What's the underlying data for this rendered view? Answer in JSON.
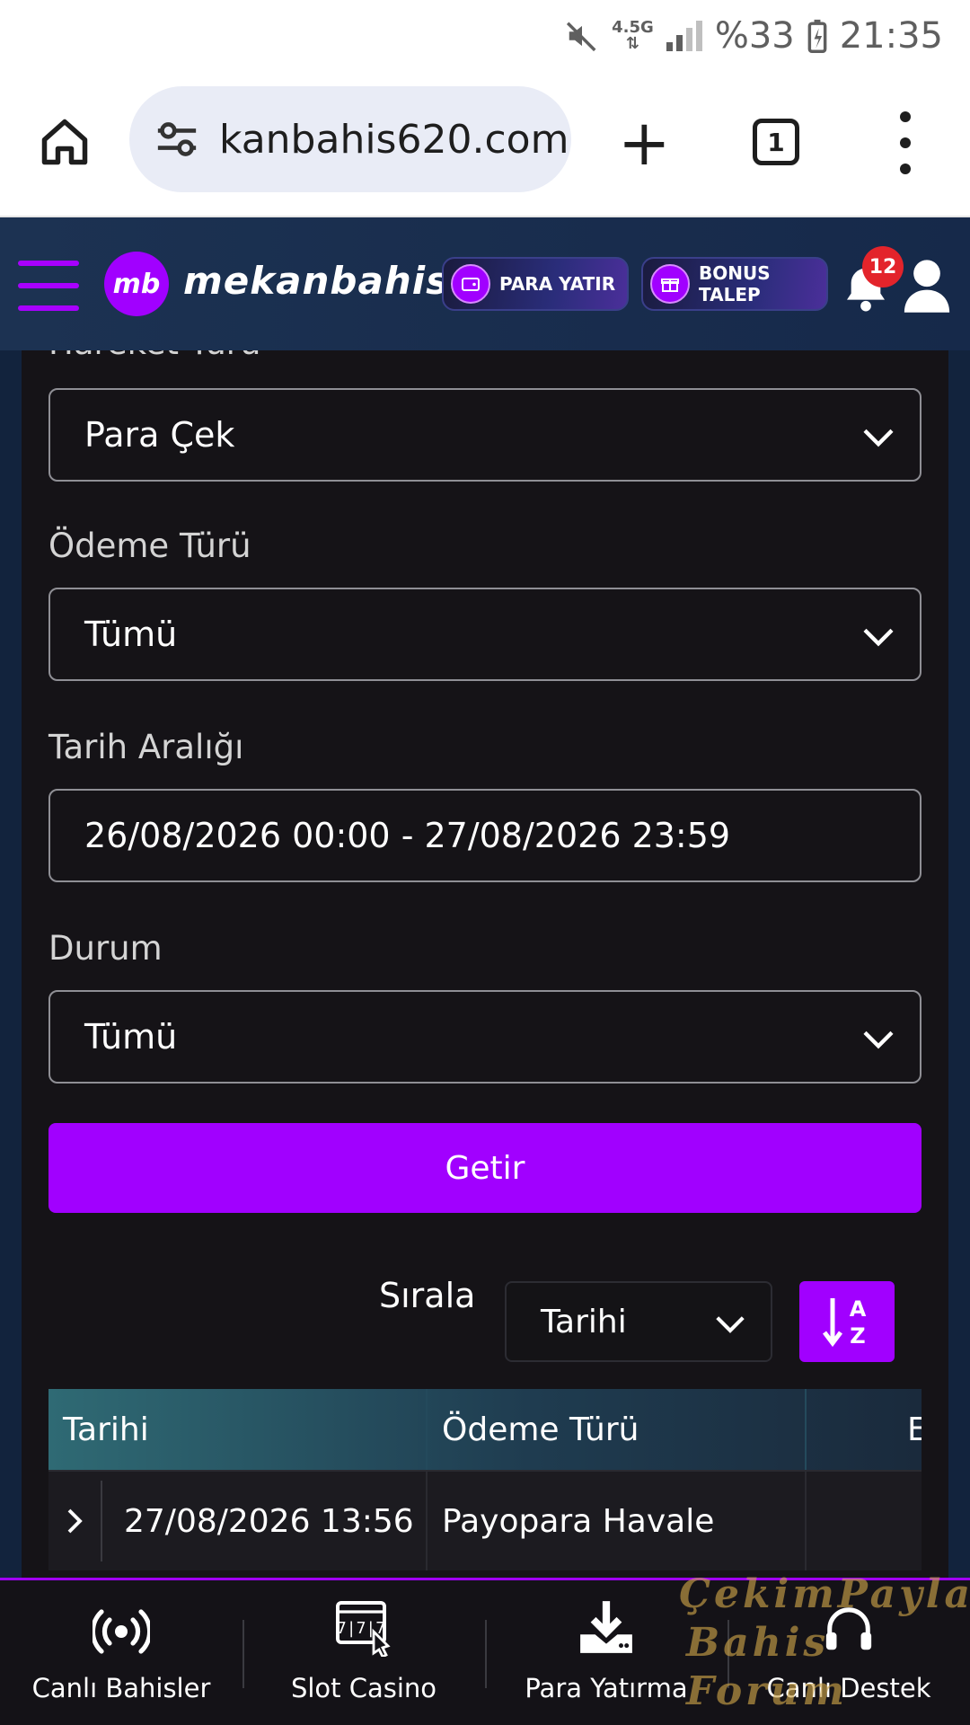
{
  "status_bar": {
    "network": "4.5G",
    "battery": "%33",
    "time": "21:35"
  },
  "browser": {
    "url": "kanbahis620.com",
    "tab_count": "1"
  },
  "site_header": {
    "logo_mark": "mb",
    "logo_text": "mekanbahis",
    "deposit_button": "PARA YATIR",
    "bonus_button": "BONUS TALEP",
    "notification_count": "12"
  },
  "form": {
    "hareket_turu": {
      "label": "Hareket Türü",
      "value": "Para Çek"
    },
    "odeme_turu": {
      "label": "Ödeme Türü",
      "value": "Tümü"
    },
    "tarih_araligi": {
      "label": "Tarih Aralığı",
      "value": "26/08/2026 00:00 - 27/08/2026 23:59"
    },
    "durum": {
      "label": "Durum",
      "value": "Tümü"
    },
    "submit_label": "Getir"
  },
  "sort": {
    "label": "Sırala",
    "value": "Tarihi",
    "order_a": "A",
    "order_z": "Z"
  },
  "table": {
    "columns": [
      "Tarihi",
      "Ödeme Türü",
      "E"
    ],
    "rows": [
      {
        "date": "27/08/2026 13:56",
        "payment_type": "Payopara Havale"
      }
    ]
  },
  "bottom_nav": {
    "items": [
      {
        "label": "Canlı Bahisler",
        "icon": "live-broadcast-icon"
      },
      {
        "label": "Slot Casino",
        "icon": "slot-machine-icon"
      },
      {
        "label": "Para Yatırma",
        "icon": "download-icon"
      },
      {
        "label": "Canlı Destek",
        "icon": "headset-icon"
      }
    ]
  },
  "watermark": {
    "line1": "ÇekimPaylas",
    "line2": "Bahis Forum"
  },
  "colors": {
    "accent": "#a100ff",
    "header_bg": "#1c3252",
    "card_bg": "#151317",
    "badge": "#e3242b"
  }
}
